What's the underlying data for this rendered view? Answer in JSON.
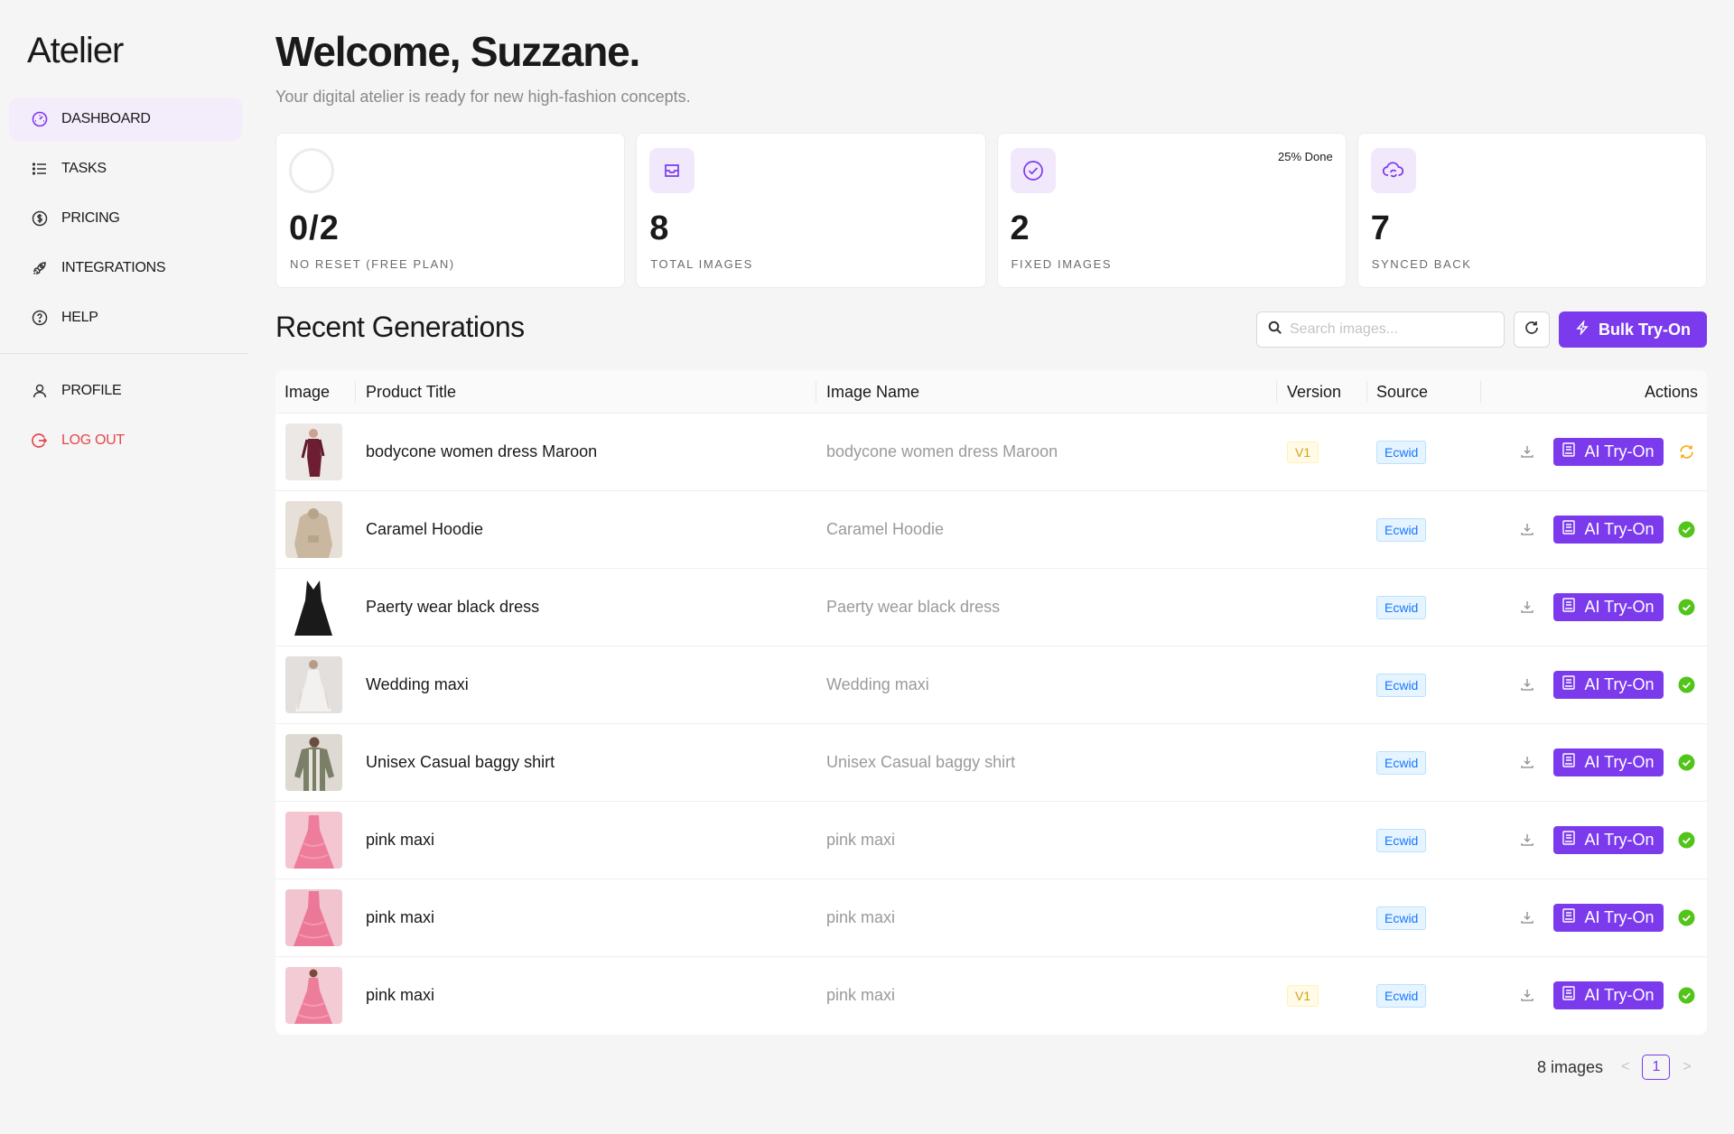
{
  "app": {
    "logo": "Atelier"
  },
  "sidebar": {
    "items": [
      {
        "label": "DASHBOARD",
        "icon": "dashboard-gauge-icon",
        "active": true
      },
      {
        "label": "TASKS",
        "icon": "list-icon"
      },
      {
        "label": "PRICING",
        "icon": "dollar-circle-icon"
      },
      {
        "label": "INTEGRATIONS",
        "icon": "rocket-icon"
      },
      {
        "label": "HELP",
        "icon": "question-circle-icon"
      }
    ],
    "account": [
      {
        "label": "PROFILE",
        "icon": "user-icon"
      },
      {
        "label": "LOG OUT",
        "icon": "logout-icon"
      }
    ]
  },
  "header": {
    "title": "Welcome, Suzzane.",
    "subtitle": "Your digital atelier is ready for new high-fashion concepts."
  },
  "stats": [
    {
      "value": "0/2",
      "label": "NO RESET (FREE PLAN)",
      "icon": "progress-ring"
    },
    {
      "value": "8",
      "label": "TOTAL IMAGES",
      "icon": "inbox-icon"
    },
    {
      "value": "2",
      "label": "FIXED IMAGES",
      "icon": "check-circle-icon",
      "badge": "25% Done"
    },
    {
      "value": "7",
      "label": "SYNCED BACK",
      "icon": "cloud-sync-icon"
    }
  ],
  "recent": {
    "title": "Recent Generations",
    "search_placeholder": "Search images...",
    "bulk_label": "Bulk Try-On",
    "columns": [
      "Image",
      "Product Title",
      "Image Name",
      "Version",
      "Source",
      "Actions"
    ],
    "action_label": "AI Try-On",
    "rows": [
      {
        "title": "bodycone women dress Maroon",
        "name": "bodycone women dress Maroon",
        "version": "V1",
        "source": "Ecwid",
        "status": "syncing"
      },
      {
        "title": "Caramel Hoodie",
        "name": "Caramel Hoodie",
        "version": "",
        "source": "Ecwid",
        "status": "done"
      },
      {
        "title": "Paerty wear black dress",
        "name": "Paerty wear black dress",
        "version": "",
        "source": "Ecwid",
        "status": "done"
      },
      {
        "title": "Wedding maxi",
        "name": "Wedding maxi",
        "version": "",
        "source": "Ecwid",
        "status": "done"
      },
      {
        "title": "Unisex Casual baggy shirt",
        "name": "Unisex Casual baggy shirt",
        "version": "",
        "source": "Ecwid",
        "status": "done"
      },
      {
        "title": "pink maxi",
        "name": "pink maxi",
        "version": "",
        "source": "Ecwid",
        "status": "done"
      },
      {
        "title": "pink maxi",
        "name": "pink maxi",
        "version": "",
        "source": "Ecwid",
        "status": "done"
      },
      {
        "title": "pink maxi",
        "name": "pink maxi",
        "version": "V1",
        "source": "Ecwid",
        "status": "done"
      }
    ]
  },
  "pagination": {
    "count_label": "8 images",
    "page": "1",
    "prev": "<",
    "next": ">"
  },
  "colors": {
    "accent": "#7c3aed",
    "success": "#52c41a",
    "warning": "#faad14",
    "danger": "#e5484d"
  }
}
